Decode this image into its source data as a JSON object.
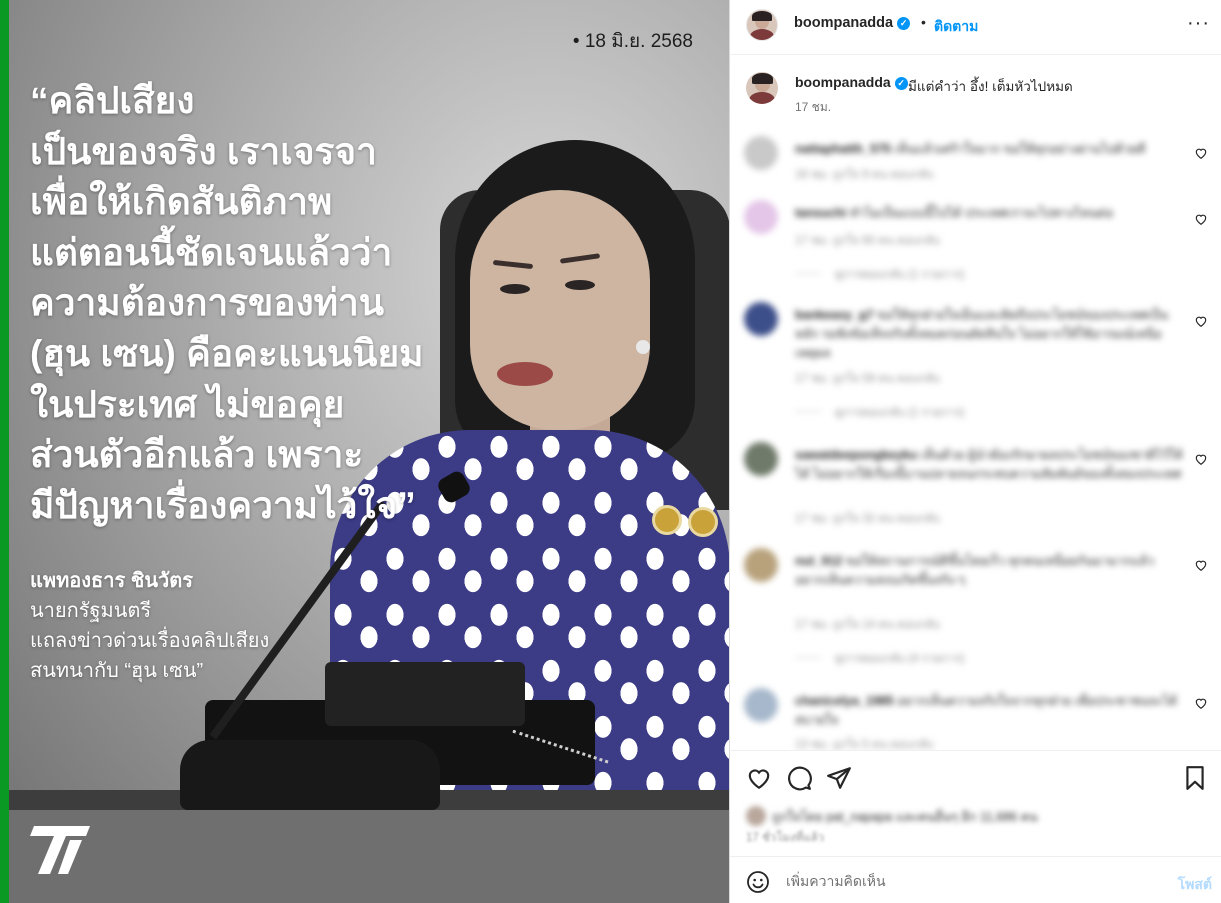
{
  "image": {
    "date": "• 18 มิ.ย. 2568",
    "quote_lines": [
      "“คลิปเสียง",
      "เป็นของจริง เราเจรจา",
      "เพื่อให้เกิดสันติภาพ",
      "แต่ตอนนี้ชัดเจนแล้วว่า",
      "ความต้องการของท่าน",
      "(ฮุน เซน) คือคะแนนนิยม",
      "ในประเทศ ไม่ขอคุย",
      "ส่วนตัวอีกแล้ว เพราะ",
      "มีปัญหาเรื่องความไว้ใจ”"
    ],
    "speaker_name": "แพทองธาร ชินวัตร",
    "speaker_lines": [
      "นายกรัฐมนตรี",
      "แถลงข่าวด่วนเรื่องคลิปเสียง",
      "สนทนากับ “ฮุน เซน”"
    ],
    "accent_color": "#0a9a23"
  },
  "header": {
    "username": "boompanadda",
    "verified_mark": "✓",
    "separator": "•",
    "follow_label": "ติดตาม",
    "more_label": "···"
  },
  "caption": {
    "username": "boompanadda",
    "text": "มีแต่คำว่า อึ้ง! เต็มหัวไปหมด",
    "time": "17 ชม."
  },
  "comments": [
    {
      "user": "nattaphatth_575",
      "text": "เห็นแล้วเศร้าใจมาก ขอให้ทุกอย่างผ่านไปด้วยดี",
      "meta": "16 ชม.   ถูกใจ 9 คน   ตอบกลับ",
      "replies": ""
    },
    {
      "user": "tansuchi",
      "text": "ทำไมเป็นแบบนี้ไปได้ ประเทศเราจะไปทางไหนต่อ",
      "meta": "17 ชม.   ถูกใจ 60 คน   ตอบกลับ",
      "replies": "ดูการตอบกลับ (1 รายการ)"
    },
    {
      "user": "bankeasy_g7",
      "text": "ขอให้ทุกฝ่ายใจเย็นและคิดถึงประโยชน์ของประเทศเป็นหลัก รอฟังข้อเท็จจริงทั้งหมดก่อนตัดสินใจ ไม่อยากให้ใช้อารมณ์เหนือเหตุผล",
      "meta": "17 ชม.   ถูกใจ 59 คน   ตอบกลับ",
      "replies": "ดูการตอบกลับ (1 รายการ)"
    },
    {
      "user": "sawatdeepongkeyku",
      "text": "เห็นด้วย ผู้นำต้องรักษาผลประโยชน์ของชาติไว้ให้ได้ ไม่อยากให้เรื่องนี้บานปลายจนกระทบความสัมพันธ์ของทั้งสองประเทศ",
      "meta": "17 ชม.   ถูกใจ 32 คน   ตอบกลับ",
      "replies": ""
    },
    {
      "user": "nut_912",
      "text": "ขอให้สถานการณ์ดีขึ้นโดยเร็ว ทุกคนเหนื่อยกันมามากแล้ว อยากเห็นความสงบเกิดขึ้นจริง ๆ",
      "meta": "17 ชม.   ถูกใจ 14 คน   ตอบกลับ",
      "replies": "ดูการตอบกลับ (4 รายการ)"
    },
    {
      "user": "chanicelya_1985",
      "text": "อยากเห็นความจริงใจจากทุกฝ่าย เพื่อประชาชนจะได้สบายใจ",
      "meta": "13 ชม.   ถูกใจ 5 คน   ตอบกลับ",
      "replies": ""
    }
  ],
  "actions": {
    "likes_text": "ถูกใจโดย pat_napapa และคนอื่นๆ อีก 11,686 คน",
    "post_time": "17 ชั่วโมงที่แล้ว"
  },
  "comment_box": {
    "placeholder": "เพิ่มความคิดเห็น",
    "post_label": "โพสต์"
  },
  "colors": {
    "link": "#0095f6",
    "post_disabled": "#b3dbff",
    "muted": "#737373"
  },
  "icons": [
    "heart-icon",
    "comment-icon",
    "share-icon",
    "bookmark-icon",
    "emoji-icon",
    "verified-icon",
    "more-icon"
  ]
}
